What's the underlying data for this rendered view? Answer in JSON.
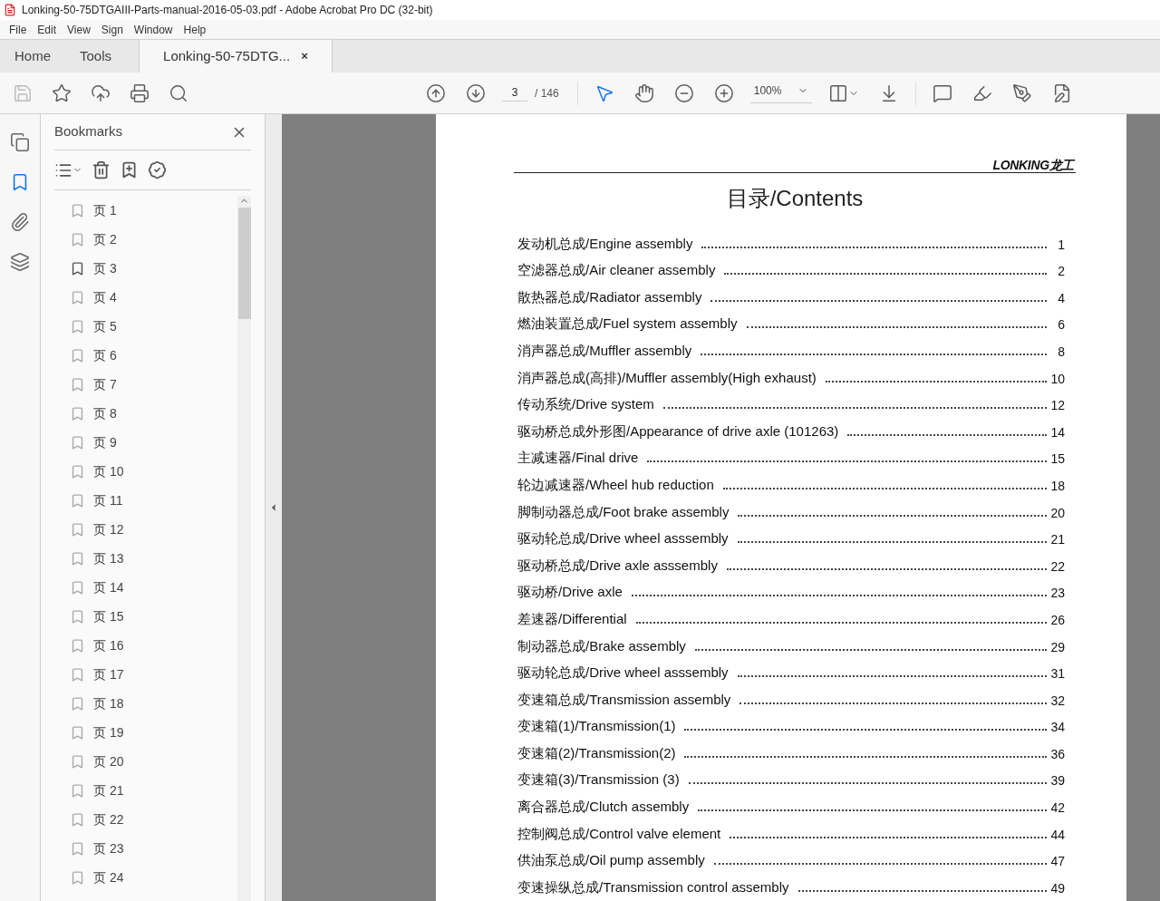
{
  "window": {
    "title": "Lonking-50-75DTGAIII-Parts-manual-2016-05-03.pdf - Adobe Acrobat Pro DC (32-bit)"
  },
  "menu": [
    "File",
    "Edit",
    "View",
    "Sign",
    "Window",
    "Help"
  ],
  "tabs": [
    {
      "label": "Home",
      "selected": false
    },
    {
      "label": "Tools",
      "selected": false
    },
    {
      "label": "Lonking-50-75DTG...",
      "selected": true,
      "close": "×"
    }
  ],
  "toolbar": {
    "save_disabled": true,
    "page": "3",
    "page_total": "/ 146",
    "zoom": "100%",
    "tools": [
      {
        "kind": "select",
        "selected": true
      },
      {
        "kind": "hand",
        "selected": false
      }
    ]
  },
  "rail": [
    {
      "kind": "pages",
      "selected": false
    },
    {
      "kind": "bookmarks",
      "selected": true
    },
    {
      "kind": "attachments",
      "selected": false
    },
    {
      "kind": "layers",
      "selected": false
    }
  ],
  "bookmarks": {
    "title": "Bookmarks",
    "items": [
      {
        "label": "页 1",
        "current": false
      },
      {
        "label": "页 2",
        "current": false
      },
      {
        "label": "页 3",
        "current": true
      },
      {
        "label": "页 4",
        "current": false
      },
      {
        "label": "页 5",
        "current": false
      },
      {
        "label": "页 6",
        "current": false
      },
      {
        "label": "页 7",
        "current": false
      },
      {
        "label": "页 8",
        "current": false
      },
      {
        "label": "页 9",
        "current": false
      },
      {
        "label": "页 10",
        "current": false
      },
      {
        "label": "页 11",
        "current": false
      },
      {
        "label": "页 12",
        "current": false
      },
      {
        "label": "页 13",
        "current": false
      },
      {
        "label": "页 14",
        "current": false
      },
      {
        "label": "页 15",
        "current": false
      },
      {
        "label": "页 16",
        "current": false
      },
      {
        "label": "页 17",
        "current": false
      },
      {
        "label": "页 18",
        "current": false
      },
      {
        "label": "页 19",
        "current": false
      },
      {
        "label": "页 20",
        "current": false
      },
      {
        "label": "页 21",
        "current": false
      },
      {
        "label": "页 22",
        "current": false
      },
      {
        "label": "页 23",
        "current": false
      },
      {
        "label": "页 24",
        "current": false
      }
    ]
  },
  "document": {
    "logo": "LONKING龙工",
    "heading": "目录/Contents",
    "entries": [
      {
        "title": "发动机总成/Engine assembly",
        "page": "1"
      },
      {
        "title": "空滤器总成/Air cleaner assembly",
        "page": "2"
      },
      {
        "title": "散热器总成/Radiator assembly",
        "page": "4"
      },
      {
        "title": "燃油装置总成/Fuel system assembly",
        "page": "6"
      },
      {
        "title": "消声器总成/Muffler assembly",
        "page": "8"
      },
      {
        "title": "消声器总成(高排)/Muffler assembly(High exhaust)",
        "page": "10"
      },
      {
        "title": "传动系统/Drive system",
        "page": "12"
      },
      {
        "title": "驱动桥总成外形图/Appearance of drive axle (101263)",
        "page": "14"
      },
      {
        "title": "主减速器/Final drive",
        "page": "15"
      },
      {
        "title": "轮边减速器/Wheel hub reduction",
        "page": "18"
      },
      {
        "title": "脚制动器总成/Foot brake assembly",
        "page": "20"
      },
      {
        "title": "驱动轮总成/Drive wheel asssembly",
        "page": "21"
      },
      {
        "title": "驱动桥总成/Drive axle asssembly",
        "page": "22"
      },
      {
        "title": "驱动桥/Drive axle",
        "page": "23"
      },
      {
        "title": "差速器/Differential",
        "page": "26"
      },
      {
        "title": "制动器总成/Brake assembly",
        "page": "29"
      },
      {
        "title": "驱动轮总成/Drive wheel asssembly",
        "page": "31"
      },
      {
        "title": "变速箱总成/Transmission assembly",
        "page": "32"
      },
      {
        "title": "变速箱(1)/Transmission(1)",
        "page": "34"
      },
      {
        "title": "变速箱(2)/Transmission(2)",
        "page": "36"
      },
      {
        "title": "变速箱(3)/Transmission (3)",
        "page": "39"
      },
      {
        "title": "离合器总成/Clutch  assembly",
        "page": "42"
      },
      {
        "title": "控制阀总成/Control valve element",
        "page": "44"
      },
      {
        "title": "供油泵总成/Oil pump assembly",
        "page": "47"
      },
      {
        "title": "变速操纵总成/Transmission control assembly",
        "page": "49"
      }
    ]
  }
}
